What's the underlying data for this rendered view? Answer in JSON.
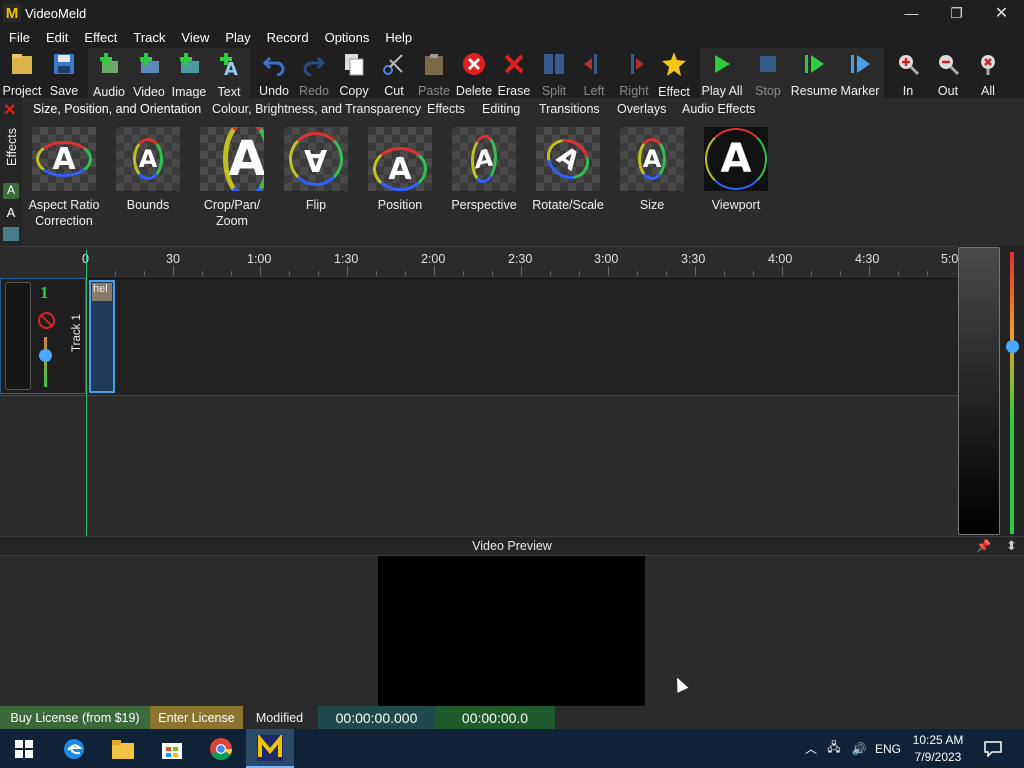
{
  "window": {
    "title": "VideoMeld",
    "minimize": "—",
    "restore": "❐",
    "close": "✕"
  },
  "menu": [
    "File",
    "Edit",
    "Effect",
    "Track",
    "View",
    "Play",
    "Record",
    "Options",
    "Help"
  ],
  "toolbar": {
    "project": "Project",
    "save": "Save",
    "audio": "Audio",
    "video": "Video",
    "image": "Image",
    "text": "Text",
    "undo": "Undo",
    "redo": "Redo",
    "copy": "Copy",
    "cut": "Cut",
    "paste": "Paste",
    "delete": "Delete",
    "erase": "Erase",
    "split": "Split",
    "left": "Left",
    "right": "Right",
    "effect": "Effect",
    "play_all": "Play All",
    "stop": "Stop",
    "resume": "Resume",
    "marker": "Marker",
    "zoom_in": "In",
    "zoom_out": "Out",
    "zoom_all": "All"
  },
  "effects": {
    "side_label": "Effects",
    "tabs": [
      "Size, Position, and Orientation",
      "Colour, Brightness, and Transparency",
      "Effects",
      "Editing",
      "Transitions",
      "Overlays",
      "Audio Effects"
    ],
    "tiles": [
      {
        "label": "Aspect Ratio Correction"
      },
      {
        "label": "Bounds"
      },
      {
        "label": "Crop/Pan/ Zoom"
      },
      {
        "label": "Flip"
      },
      {
        "label": "Position"
      },
      {
        "label": "Perspective"
      },
      {
        "label": "Rotate/Scale"
      },
      {
        "label": "Size"
      },
      {
        "label": "Viewport"
      }
    ],
    "thumb_letter": "A"
  },
  "ruler": {
    "labels": [
      "0",
      "30",
      "1:00",
      "1:30",
      "2:00",
      "2:30",
      "3:00",
      "3:30",
      "4:00",
      "4:30",
      "5:0"
    ]
  },
  "track": {
    "number": "1",
    "name": "Track 1",
    "clip_label": "hel"
  },
  "preview": {
    "title": "Video Preview"
  },
  "status": {
    "buy": "Buy License (from $19)",
    "enter": "Enter License",
    "modified": "Modified",
    "time1": "00:00:00.000",
    "time2": "00:00:00.0"
  },
  "taskbar": {
    "lang": "ENG",
    "time": "10:25 AM",
    "date": "7/9/2023"
  },
  "colors": {
    "accent_green": "#1fbf6f",
    "toolbar_play_green": "#2ecc40",
    "delete_red": "#e02020",
    "star_yellow": "#f5c518"
  }
}
